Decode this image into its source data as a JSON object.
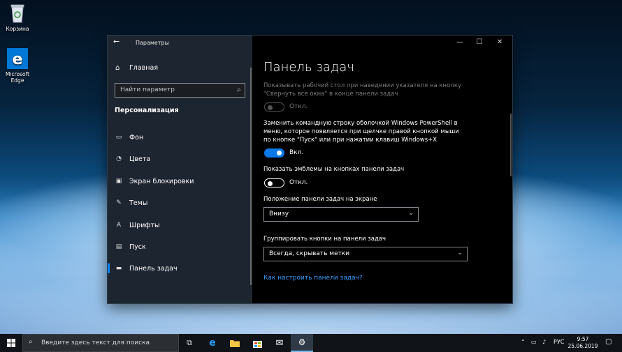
{
  "desktop": {
    "recycle_bin_label": "Корзина",
    "edge_label": "Microsoft Edge"
  },
  "window": {
    "title": "Параметры",
    "controls": {
      "minimize": "—",
      "maximize": "☐",
      "close": "✕"
    }
  },
  "nav": {
    "home_label": "Главная",
    "search_placeholder": "Найти параметр",
    "section_title": "Персонализация",
    "items": [
      {
        "label": "Фон",
        "icon": "image-icon"
      },
      {
        "label": "Цвета",
        "icon": "palette-icon"
      },
      {
        "label": "Экран блокировки",
        "icon": "lock-screen-icon"
      },
      {
        "label": "Темы",
        "icon": "brush-icon"
      },
      {
        "label": "Шрифты",
        "icon": "font-icon"
      },
      {
        "label": "Пуск",
        "icon": "start-icon"
      },
      {
        "label": "Панель задач",
        "icon": "taskbar-icon"
      }
    ],
    "selected_index": 6
  },
  "content": {
    "title": "Панель задач",
    "peek_text": "Показывать рабочий стол при наведении указателя на кнопку \"Свернуть все окна\" в конце панели задач",
    "peek_state": "Откл.",
    "powershell_text": "Заменить командную строку оболочкой Windows PowerShell в меню, которое появляется при щелчке правой кнопкой мыши по кнопке \"Пуск\" или при нажатии клавиш Windows+X",
    "powershell_state": "Вкл.",
    "badges_text": "Показать эмблемы на кнопках панели задач",
    "badges_state": "Откл.",
    "position_label": "Положение панели задач на экране",
    "position_value": "Внизу",
    "combine_label": "Группировать кнопки на панели задач",
    "combine_value": "Всегда, скрывать метки",
    "help_link": "Как настроить панели задач?"
  },
  "taskbar": {
    "search_placeholder": "Введите здесь текст для поиска",
    "language": "РУС",
    "time": "9:57",
    "date": "25.06.2019"
  },
  "colors": {
    "accent": "#0a78e8",
    "link": "#3aa0ff",
    "nav_bg": "#1f2834",
    "content_bg": "#000000"
  }
}
